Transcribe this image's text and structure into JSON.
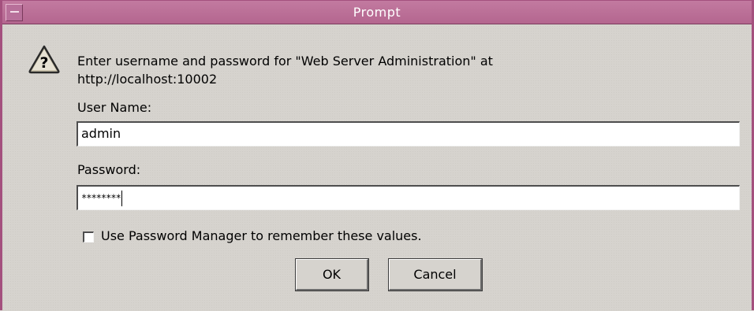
{
  "window": {
    "title": "Prompt"
  },
  "dialog": {
    "message_line1": "Enter username and password for \"Web Server Administration\" at",
    "message_line2": "http://localhost:10002",
    "username_label": "User Name:",
    "username_value": "admin",
    "password_label": "Password:",
    "password_value": "********",
    "remember_checked": false,
    "remember_label": "Use Password Manager to remember these values.",
    "ok_label": "OK",
    "cancel_label": "Cancel",
    "icon": "question-icon"
  },
  "colors": {
    "titlebar": "#b4668f",
    "border": "#a4507e",
    "background": "#d6d3ce"
  }
}
